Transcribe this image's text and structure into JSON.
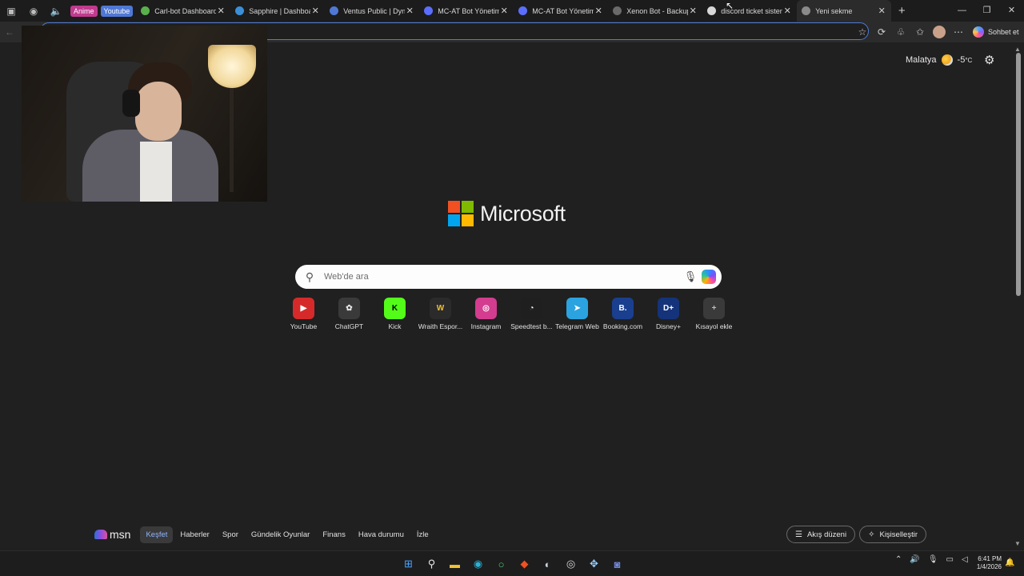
{
  "browser": {
    "tab_groups": [
      {
        "label": "Anime",
        "color": "#c03b8f"
      },
      {
        "label": "Youtube",
        "color": "#4f78d6"
      }
    ],
    "tabs": [
      {
        "title": "Carl-bot Dashboard",
        "fav": "#5ab04c"
      },
      {
        "title": "Sapphire | Dashboard",
        "fav": "#3b8fd6"
      },
      {
        "title": "Ventus Public | Dyno",
        "fav": "#4f78d6"
      },
      {
        "title": "MC-AT Bot Yönetim Pa",
        "fav": "#5b6eff"
      },
      {
        "title": "MC-AT Bot Yönetim Pa",
        "fav": "#5b6eff"
      },
      {
        "title": "Xenon Bot - Backups a",
        "fav": "#6a6a6a"
      },
      {
        "title": "discord ticket sistemi n",
        "fav": "#d8d8d8"
      },
      {
        "title": "Yeni sekme",
        "fav": "#8a8a8a",
        "active": true
      }
    ],
    "chat_button": "Sohbet et"
  },
  "weather": {
    "city": "Malatya",
    "temp": "-5",
    "unit": "°C"
  },
  "logo": {
    "text": "Microsoft"
  },
  "search": {
    "placeholder": "Web'de ara"
  },
  "shortcuts": [
    {
      "label": "YouTube",
      "glyph": "▶",
      "bg": "#d62a2a",
      "fg": "#ffffff"
    },
    {
      "label": "ChatGPT",
      "glyph": "✿",
      "bg": "#3a3a3a",
      "fg": "#e6e6e6"
    },
    {
      "label": "Kick",
      "glyph": "K",
      "bg": "#53fc18",
      "fg": "#000000"
    },
    {
      "label": "Wraith Espor...",
      "glyph": "W",
      "bg": "#2b2b2b",
      "fg": "#f2c232"
    },
    {
      "label": "Instagram",
      "glyph": "◎",
      "bg": "#d43c8f",
      "fg": "#ffffff"
    },
    {
      "label": "Speedtest b...",
      "glyph": "◔",
      "bg": "#1f1f1f",
      "fg": "#ffffff"
    },
    {
      "label": "Telegram Web",
      "glyph": "➤",
      "bg": "#2aa3e0",
      "fg": "#ffffff"
    },
    {
      "label": "Booking.com",
      "glyph": "B.",
      "bg": "#1a3f8f",
      "fg": "#ffffff"
    },
    {
      "label": "Disney+",
      "glyph": "D+",
      "bg": "#14337a",
      "fg": "#ffffff"
    },
    {
      "label": "Kısayol ekle",
      "glyph": "+",
      "bg": "#3a3a3a",
      "fg": "#bdbdbd"
    }
  ],
  "msn": {
    "logo": "msn",
    "nav": [
      "Keşfet",
      "Haberler",
      "Spor",
      "Gündelik Oyunlar",
      "Finans",
      "Hava durumu",
      "İzle"
    ],
    "feed_layout": "Akış düzeni",
    "personalize": "Kişiselleştir"
  },
  "taskbar": {
    "apps": [
      {
        "icon": "windows-start",
        "glyph": "⊞",
        "color": "#4aa3ff"
      },
      {
        "icon": "search",
        "glyph": "⚲",
        "color": "#e6e6e6"
      },
      {
        "icon": "file-explorer",
        "glyph": "▬",
        "color": "#f2c232"
      },
      {
        "icon": "edge",
        "glyph": "◉",
        "color": "#2bb3d6"
      },
      {
        "icon": "obs-or-app",
        "glyph": "○",
        "color": "#4fd07a"
      },
      {
        "icon": "brave",
        "glyph": "◆",
        "color": "#f25022"
      },
      {
        "icon": "steam",
        "glyph": "◐",
        "color": "#c7d5e0"
      },
      {
        "icon": "app-with-badge",
        "glyph": "◎",
        "color": "#d8d8d8"
      },
      {
        "icon": "app",
        "glyph": "✥",
        "color": "#9ad0ff"
      },
      {
        "icon": "discord",
        "glyph": "◙",
        "color": "#7289da"
      }
    ],
    "time": "6:41 PM",
    "date": "1/4/2026"
  }
}
